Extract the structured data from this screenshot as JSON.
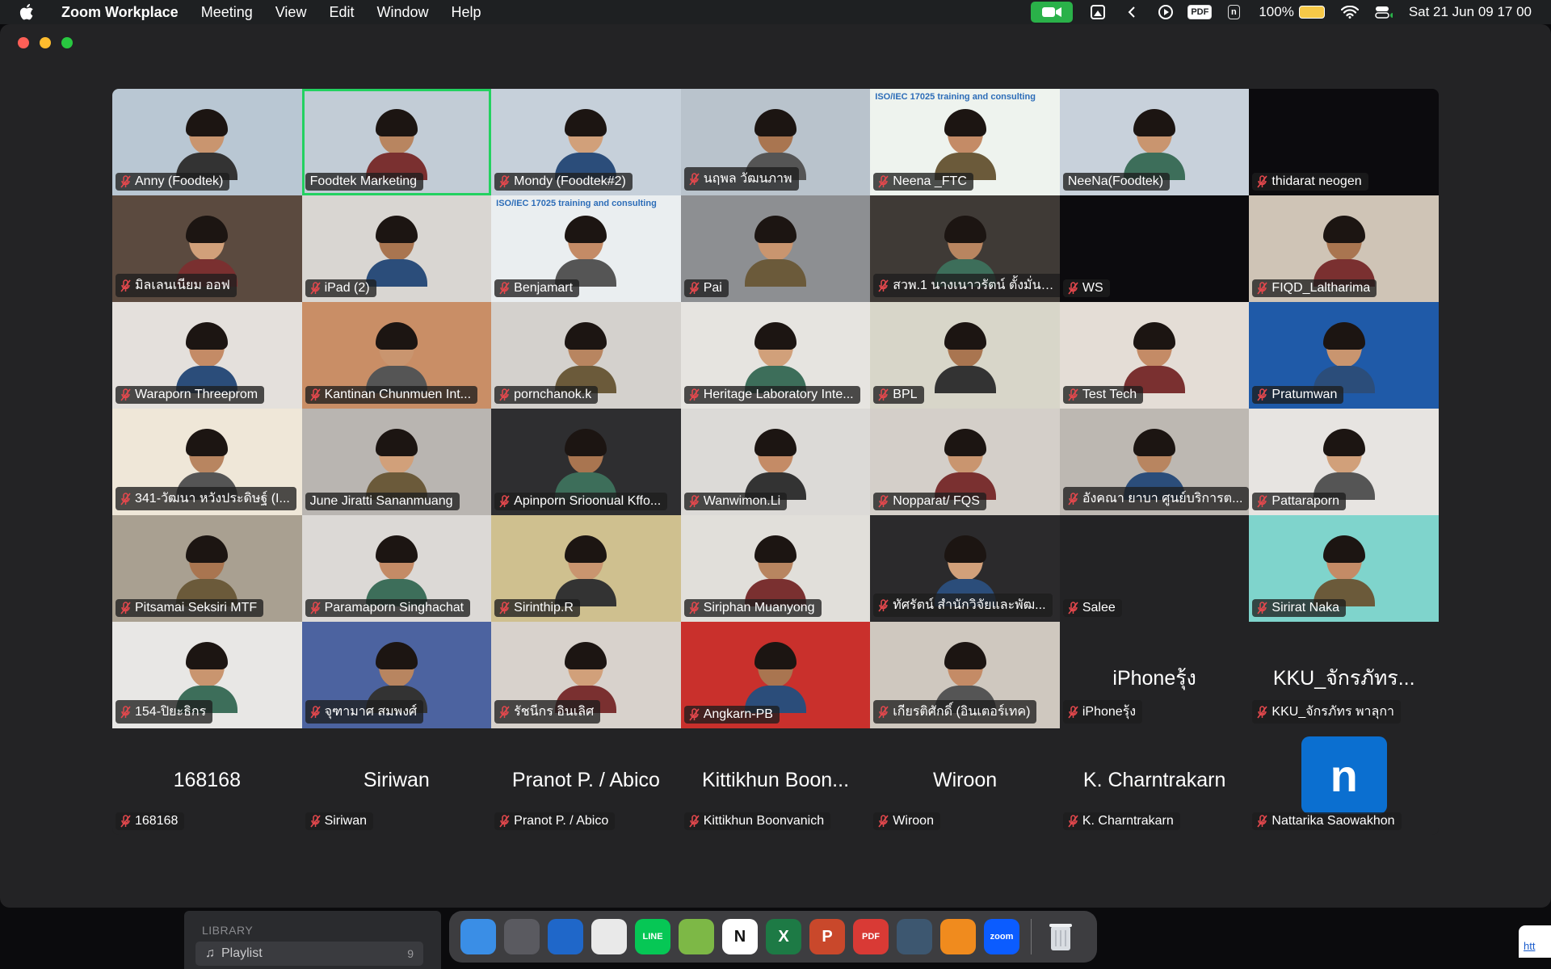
{
  "menubar": {
    "app_name": "Zoom Workplace",
    "menus": [
      "Meeting",
      "View",
      "Edit",
      "Window",
      "Help"
    ],
    "battery": "100%",
    "datetime": "Sat 21 Jun  09 17 00",
    "icons": [
      "zoom-camera-icon",
      "stage-icon",
      "chevron-left-icon",
      "play-icon",
      "pdf-icon",
      "notion-icon",
      "battery-icon",
      "wifi-icon",
      "control-center-icon"
    ]
  },
  "participants": [
    {
      "label": "Anny (Foodtek)",
      "video": true,
      "bg": "#b9c7d3",
      "muted": true
    },
    {
      "label": "Foodtek Marketing",
      "video": true,
      "bg": "#c2ccd6",
      "muted": false,
      "active": true
    },
    {
      "label": "Mondy (Foodtek#2)",
      "video": true,
      "bg": "#c6d0da",
      "muted": true
    },
    {
      "label": "นฤพล วัฒนภาพ",
      "video": true,
      "bg": "#b9c3cc",
      "muted": true
    },
    {
      "label": "Neena _FTC",
      "video": true,
      "bg": "#eef3ee",
      "muted": true,
      "banner": "ISO/IEC 17025 training and consulting"
    },
    {
      "label": "NeeNa(Foodtek)",
      "video": true,
      "bg": "#c8d1db",
      "muted": false
    },
    {
      "label": "thidarat neogen",
      "video": false,
      "bg": "#0c0b0e",
      "muted": true
    },
    {
      "label": "มิลเลนเนียม ออฟ",
      "video": true,
      "bg": "#5b4a3f",
      "muted": true
    },
    {
      "label": "iPad (2)",
      "video": true,
      "bg": "#d9d6d2",
      "muted": true
    },
    {
      "label": "Benjamart",
      "video": true,
      "bg": "#eaeef0",
      "muted": true,
      "banner": "ISO/IEC 17025 training and consulting"
    },
    {
      "label": "Pai",
      "video": true,
      "bg": "#8d8f92",
      "muted": true
    },
    {
      "label": "สวพ.1 นางเนาวรัตน์ ตั้งมั่นค...",
      "video": true,
      "bg": "#3f3a36",
      "muted": true
    },
    {
      "label": "WS",
      "video": false,
      "bg": "#0c0b0e",
      "muted": true
    },
    {
      "label": "FIQD_Laltharima",
      "video": true,
      "bg": "#cfc4b6",
      "muted": true
    },
    {
      "label": "Waraporn Threeprom",
      "video": true,
      "bg": "#e4e0dc",
      "muted": true
    },
    {
      "label": "Kantinan Chunmuen Int...",
      "video": true,
      "bg": "#c98e66",
      "muted": true
    },
    {
      "label": "pornchanok.k",
      "video": true,
      "bg": "#d4d1cd",
      "muted": true
    },
    {
      "label": "Heritage Laboratory Inte...",
      "video": true,
      "bg": "#e6e4e0",
      "muted": true
    },
    {
      "label": "BPL",
      "video": true,
      "bg": "#d8d6c9",
      "muted": true
    },
    {
      "label": "Test Tech",
      "video": true,
      "bg": "#e4ddd6",
      "muted": true
    },
    {
      "label": "Pratumwan",
      "video": true,
      "bg": "#1f5aa8",
      "muted": true
    },
    {
      "label": "341-วัฒนา หวังประดิษฐ์ (I...",
      "video": true,
      "bg": "#efe7d8",
      "muted": true
    },
    {
      "label": "June Jiratti Sananmuang",
      "video": true,
      "bg": "#b9b5b1",
      "muted": false
    },
    {
      "label": "Apinporn Srioonual  Kffo...",
      "video": true,
      "bg": "#2e2e30",
      "muted": true
    },
    {
      "label": "Wanwimon.Li",
      "video": true,
      "bg": "#dcdad7",
      "muted": true
    },
    {
      "label": "Nopparat/ FQS",
      "video": true,
      "bg": "#d4cfc9",
      "muted": true
    },
    {
      "label": "อังคณา ยาบา ศูนย์บริการต...",
      "video": true,
      "bg": "#bdb8b2",
      "muted": true
    },
    {
      "label": "Pattaraporn",
      "video": true,
      "bg": "#e7e4e1",
      "muted": true
    },
    {
      "label": "Pitsamai Seksiri MTF",
      "video": true,
      "bg": "#a9a091",
      "muted": true
    },
    {
      "label": "Paramaporn Singhachat",
      "video": true,
      "bg": "#dcd9d6",
      "muted": true
    },
    {
      "label": "Sirinthip.R",
      "video": true,
      "bg": "#cfc08f",
      "muted": true
    },
    {
      "label": "Siriphan Muanyong",
      "video": true,
      "bg": "#e1dfda",
      "muted": true
    },
    {
      "label": "ทัศรัตน์  สำนักวิจัยและพัฒ...",
      "video": true,
      "bg": "#2b2a2c",
      "muted": true
    },
    {
      "label": "Salee",
      "video": false,
      "bg": "#232325",
      "muted": true
    },
    {
      "label": "Sirirat Naka",
      "video": true,
      "bg": "#7fd4cc",
      "muted": true
    },
    {
      "label": "154-ปิยะธิกร",
      "video": true,
      "bg": "#e8e7e5",
      "muted": true
    },
    {
      "label": "จุฑามาศ สมพงศ์",
      "video": true,
      "bg": "#4c63a0",
      "muted": true
    },
    {
      "label": "รัชนีกร อินเลิศ",
      "video": true,
      "bg": "#d8d2cc",
      "muted": true
    },
    {
      "label": "Angkarn-PB",
      "video": true,
      "bg": "#c9302c",
      "muted": true
    },
    {
      "label": "เกียรติศักดิ์  (อินเตอร์เทค)",
      "video": true,
      "bg": "#cfc8bf",
      "muted": true
    },
    {
      "label": "iPhoneรุ้ง",
      "video": false,
      "big": "iPhoneรุ้ง",
      "bg": "#232325",
      "muted": true
    },
    {
      "label": "KKU_จักรภัทร พาลุกา",
      "video": false,
      "big": "KKU_จักรภัทร...",
      "bg": "#232325",
      "muted": true
    },
    {
      "label": "168168",
      "video": false,
      "big": "168168",
      "bg": "#232325",
      "muted": true
    },
    {
      "label": "Siriwan",
      "video": false,
      "big": "Siriwan",
      "bg": "#232325",
      "muted": true
    },
    {
      "label": "Pranot P. / Abico",
      "video": false,
      "big": "Pranot P. / Abico",
      "bg": "#232325",
      "muted": true
    },
    {
      "label": "Kittikhun Boonvanich",
      "video": false,
      "big": "Kittikhun Boon...",
      "bg": "#232325",
      "muted": true
    },
    {
      "label": "Wiroon",
      "video": false,
      "big": "Wiroon",
      "bg": "#232325",
      "muted": true
    },
    {
      "label": "K. Charntrakarn",
      "video": false,
      "big": "K. Charntrakarn",
      "bg": "#232325",
      "muted": true
    },
    {
      "label": "Nattarika Saowakhon",
      "video": false,
      "avatar_letter": "n",
      "bg": "#232325",
      "muted": true
    }
  ],
  "library": {
    "title": "LIBRARY",
    "playlist_label": "Playlist",
    "playlist_count": "9"
  },
  "dock": {
    "apps": [
      {
        "name": "finder-icon",
        "color": "#3a8ee6",
        "text": ""
      },
      {
        "name": "launchpad-icon",
        "color": "#5a5a60",
        "text": ""
      },
      {
        "name": "thunderbird-icon",
        "color": "#1f67c9",
        "text": ""
      },
      {
        "name": "chrome-icon",
        "color": "#e9e9e9",
        "text": ""
      },
      {
        "name": "line-icon",
        "color": "#06c755",
        "text": "LINE"
      },
      {
        "name": "draw-icon",
        "color": "#7db846",
        "text": ""
      },
      {
        "name": "notion-icon",
        "color": "#ffffff",
        "text": "N"
      },
      {
        "name": "excel-icon",
        "color": "#1d7a45",
        "text": "X"
      },
      {
        "name": "powerpoint-icon",
        "color": "#c9482b",
        "text": "P"
      },
      {
        "name": "pdf-expert-icon",
        "color": "#d93a35",
        "text": "PDF"
      },
      {
        "name": "quicktime-icon",
        "color": "#3d5770",
        "text": ""
      },
      {
        "name": "vlc-icon",
        "color": "#f08b1e",
        "text": ""
      },
      {
        "name": "zoom-icon",
        "color": "#0b5cff",
        "text": "zoom"
      }
    ],
    "trash": "trash-icon"
  },
  "corner_link": "htt"
}
